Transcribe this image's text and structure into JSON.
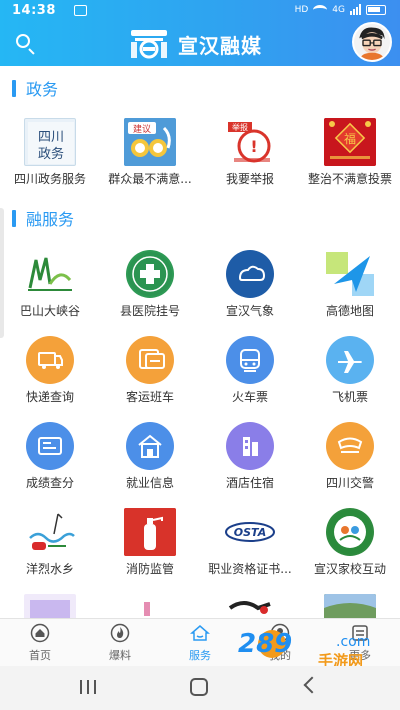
{
  "status_bar": {
    "time": "14:38",
    "network": "HD",
    "signal_type": "4G"
  },
  "header": {
    "title": "宣汉融媒"
  },
  "sections": [
    {
      "title": "政务",
      "items": [
        {
          "label": "四川政务服务",
          "icon": "sichuan-gov-icon",
          "tile_text": "四川\n政务"
        },
        {
          "label": "群众最不满意...",
          "icon": "suggestion-icon",
          "tile_text": "建议"
        },
        {
          "label": "我要举报",
          "icon": "report-icon",
          "tile_text": "举报"
        },
        {
          "label": "整治不满意投票",
          "icon": "vote-icon",
          "tile_text": "福"
        }
      ]
    },
    {
      "title": "融服务",
      "items": [
        {
          "label": "巴山大峡谷",
          "icon": "bashan-canyon-icon"
        },
        {
          "label": "县医院挂号",
          "icon": "hospital-icon"
        },
        {
          "label": "宣汉气象",
          "icon": "weather-icon"
        },
        {
          "label": "高德地图",
          "icon": "amap-icon"
        },
        {
          "label": "快递查询",
          "icon": "express-icon"
        },
        {
          "label": "客运班车",
          "icon": "bus-icon"
        },
        {
          "label": "火车票",
          "icon": "train-icon"
        },
        {
          "label": "飞机票",
          "icon": "plane-icon"
        },
        {
          "label": "成绩查分",
          "icon": "score-icon"
        },
        {
          "label": "就业信息",
          "icon": "job-icon"
        },
        {
          "label": "酒店住宿",
          "icon": "hotel-icon"
        },
        {
          "label": "四川交警",
          "icon": "police-icon"
        },
        {
          "label": "洋烈水乡",
          "icon": "yanglie-icon"
        },
        {
          "label": "消防监管",
          "icon": "fire-icon"
        },
        {
          "label": "职业资格证书...",
          "icon": "osta-icon",
          "tile_text": "OSTA"
        },
        {
          "label": "宣汉家校互动",
          "icon": "school-icon"
        }
      ]
    }
  ],
  "tabs": [
    {
      "label": "首页",
      "icon": "home-icon"
    },
    {
      "label": "爆料",
      "icon": "fire-tab-icon"
    },
    {
      "label": "服务",
      "icon": "service-icon",
      "active": true
    },
    {
      "label": "我的",
      "icon": "user-icon"
    },
    {
      "label": "更多",
      "icon": "more-icon"
    }
  ],
  "watermark": {
    "text_primary": "289",
    "text_secondary": "手游网",
    "domain_suffix": ".com"
  },
  "colors": {
    "accent": "#2a9af2",
    "orange": "#f4a13a",
    "blue": "#4c8fe8",
    "purple": "#8a7ee8",
    "header_start": "#25b7f4",
    "header_end": "#3c8ff0"
  }
}
